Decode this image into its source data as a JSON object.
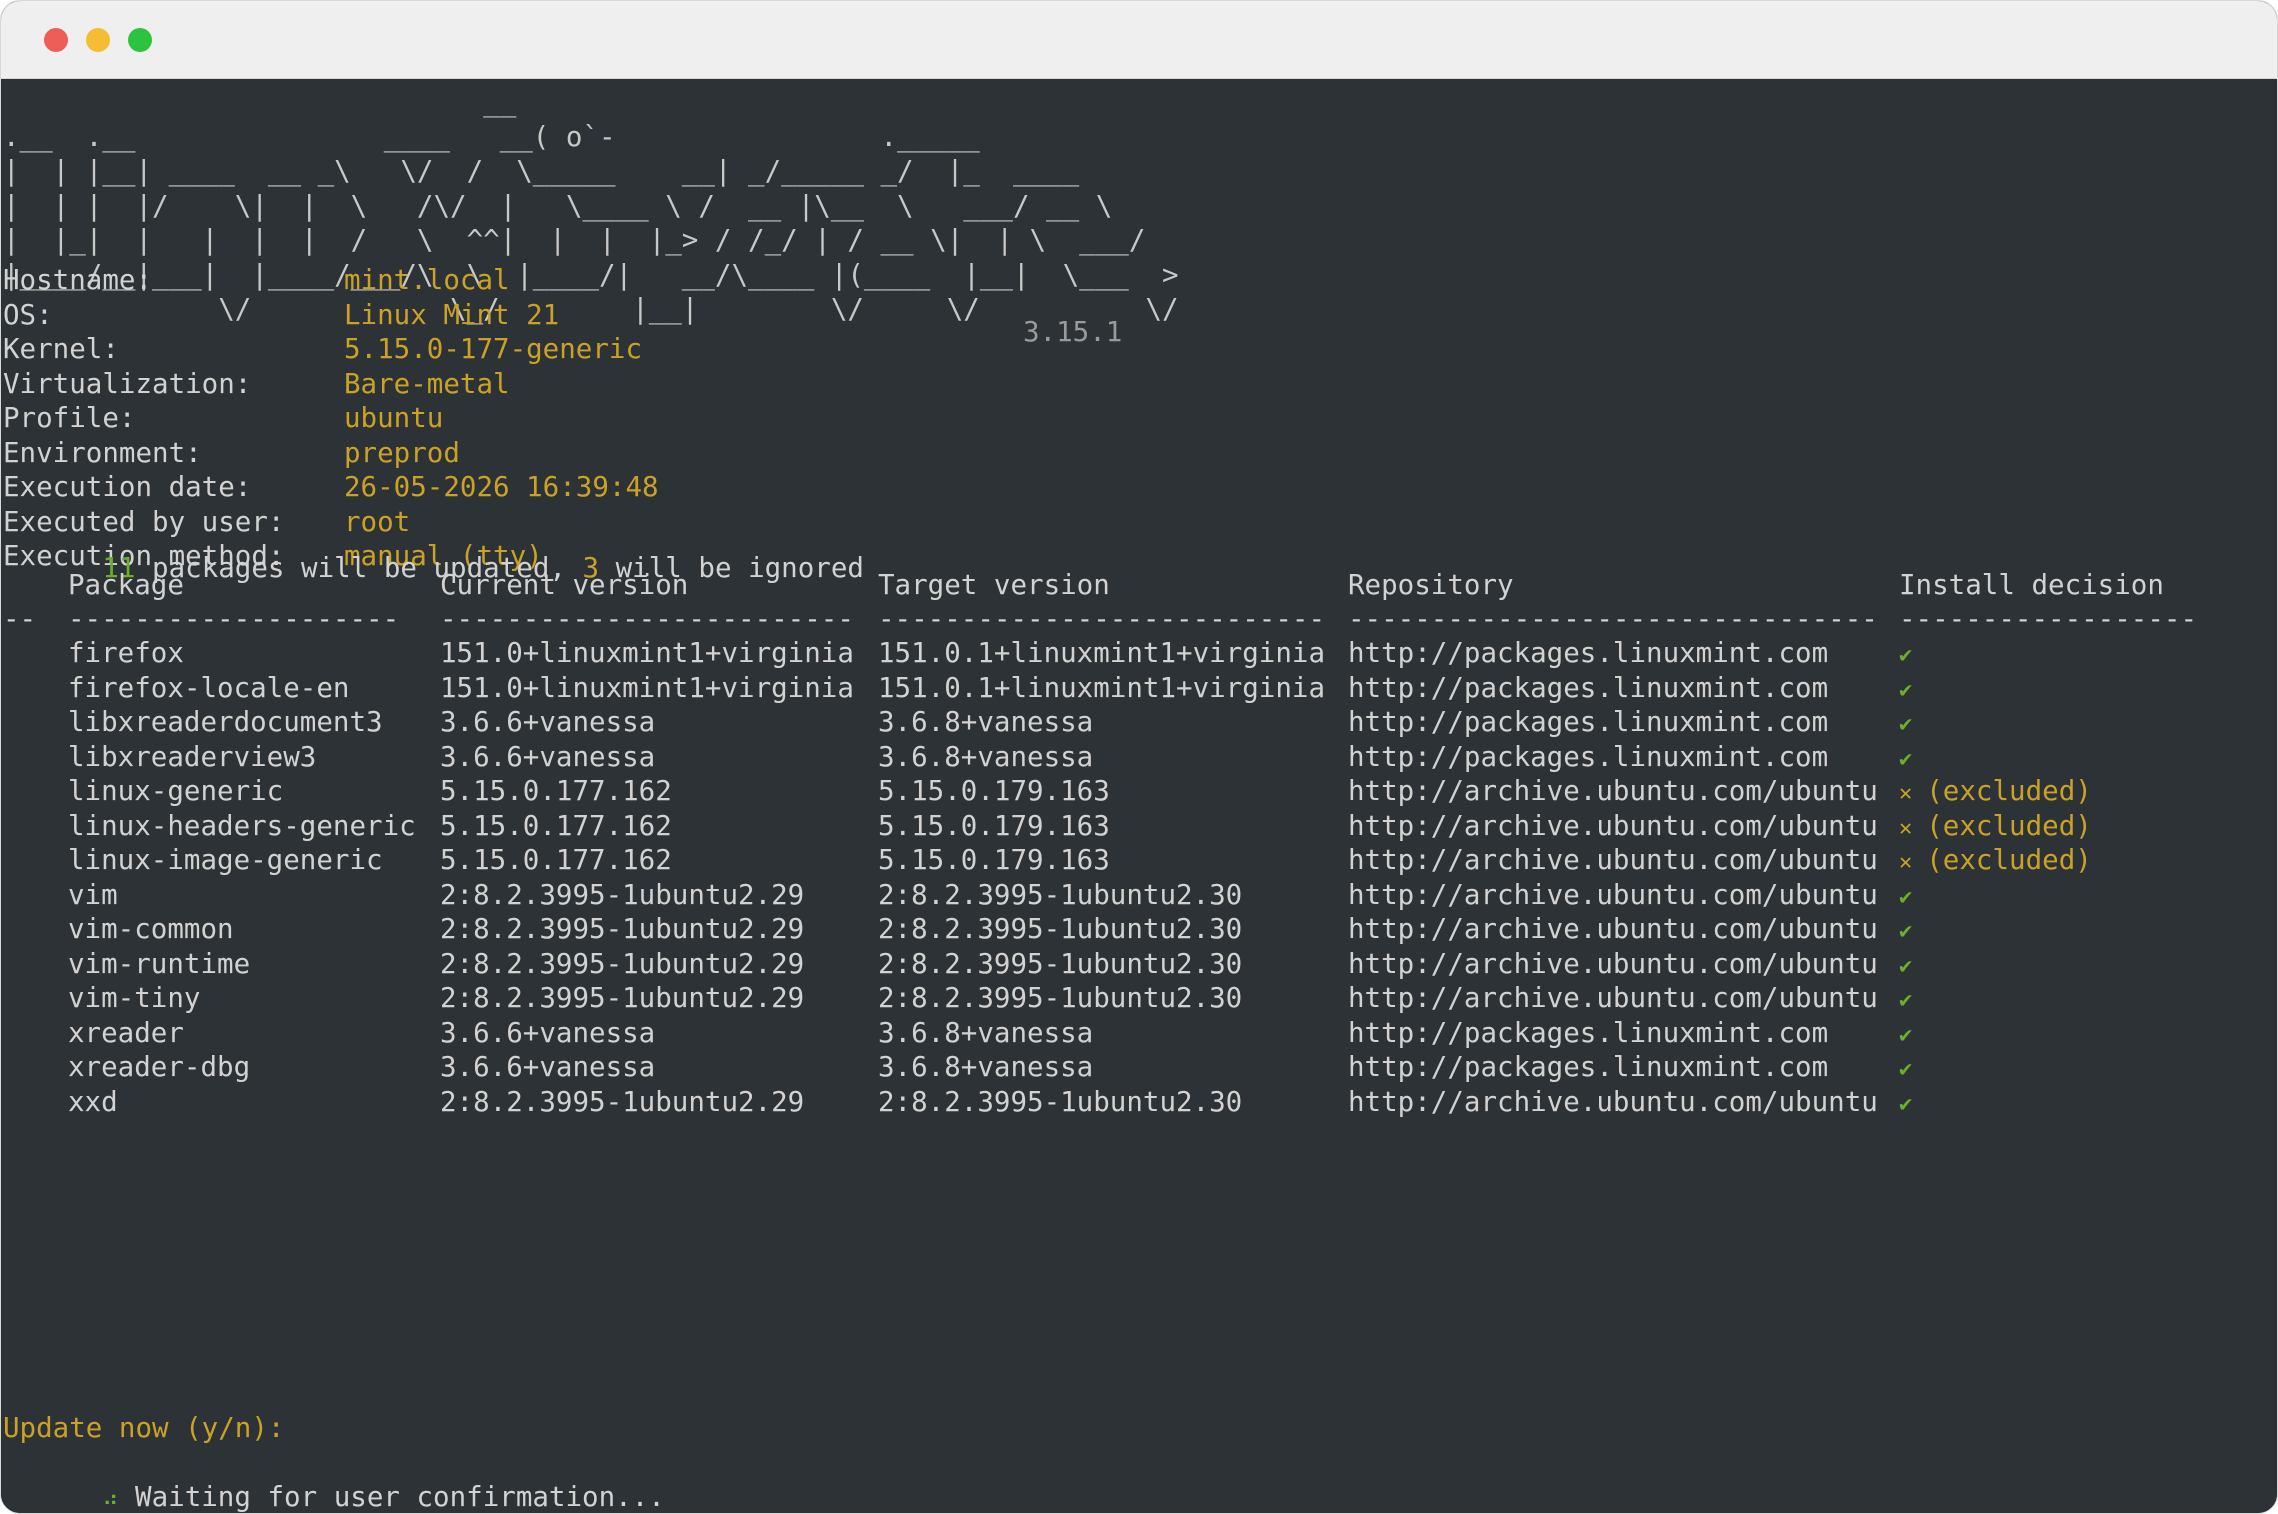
{
  "window": {
    "controls": {
      "close_color": "#ec5e57",
      "minimize_color": "#f5bd31",
      "maximize_color": "#2cc33e"
    }
  },
  "banner": {
    "logo_lines": [
      "                             __",
      ".__  .__               ____   __( o`-                ._____",
      "|  | |__| ____  __ _\\   \\/  /  \\_____    __| _/_____ _/  |_  ____",
      "|  | |  |/    \\|  |  \\   /\\/  |   \\____ \\ /  __ |\\__  \\   ___/ __ \\",
      "|  |_|  |   |  |  |  /   \\  ^^|  |  |  |_> / /_/ | / __ \\|  | \\  ___/",
      "|____/__|___|  |____/___/\\  \\  |____/|   __/\\____ |(____  |__|  \\___  >",
      "             \\/            \\_/        |__|        \\/     \\/          \\/"
    ],
    "version": "3.15.1"
  },
  "system_info": [
    {
      "label": "Hostname:",
      "value": "mint.local"
    },
    {
      "label": "OS:",
      "value": "Linux Mint 21"
    },
    {
      "label": "Kernel:",
      "value": "5.15.0-177-generic"
    },
    {
      "label": "Virtualization:",
      "value": "Bare-metal"
    },
    {
      "label": "Profile:",
      "value": "ubuntu"
    },
    {
      "label": "Environment:",
      "value": "preprod"
    },
    {
      "label": "Execution date:",
      "value": "26-05-2026 16:39:48"
    },
    {
      "label": "Executed by user:",
      "value": "root"
    },
    {
      "label": "Execution method:",
      "value": "manual (tty)"
    }
  ],
  "summary": {
    "update_count": "11",
    "text_1": " packages will be updated, ",
    "ignore_count": "3",
    "text_2": " will be ignored"
  },
  "table": {
    "headers": {
      "package": "Package",
      "current": "Current version",
      "target": "Target version",
      "repository": "Repository",
      "decision": "Install decision"
    },
    "dashes": {
      "num": "--",
      "package": "--------------------",
      "current": "-------------------------",
      "target": "---------------------------",
      "repository": "--------------------------------",
      "decision": "------------------"
    },
    "rows": [
      {
        "package": "firefox",
        "current": "151.0+linuxmint1+virginia",
        "target": "151.0.1+linuxmint1+virginia",
        "repository": "http://packages.linuxmint.com",
        "decision": "✔",
        "excluded": false
      },
      {
        "package": "firefox-locale-en",
        "current": "151.0+linuxmint1+virginia",
        "target": "151.0.1+linuxmint1+virginia",
        "repository": "http://packages.linuxmint.com",
        "decision": "✔",
        "excluded": false
      },
      {
        "package": "libxreaderdocument3",
        "current": "3.6.6+vanessa",
        "target": "3.6.8+vanessa",
        "repository": "http://packages.linuxmint.com",
        "decision": "✔",
        "excluded": false
      },
      {
        "package": "libxreaderview3",
        "current": "3.6.6+vanessa",
        "target": "3.6.8+vanessa",
        "repository": "http://packages.linuxmint.com",
        "decision": "✔",
        "excluded": false
      },
      {
        "package": "linux-generic",
        "current": "5.15.0.177.162",
        "target": "5.15.0.179.163",
        "repository": "http://archive.ubuntu.com/ubuntu",
        "decision": "✕",
        "note": "(excluded)",
        "excluded": true
      },
      {
        "package": "linux-headers-generic",
        "current": "5.15.0.177.162",
        "target": "5.15.0.179.163",
        "repository": "http://archive.ubuntu.com/ubuntu",
        "decision": "✕",
        "note": "(excluded)",
        "excluded": true
      },
      {
        "package": "linux-image-generic",
        "current": "5.15.0.177.162",
        "target": "5.15.0.179.163",
        "repository": "http://archive.ubuntu.com/ubuntu",
        "decision": "✕",
        "note": "(excluded)",
        "excluded": true
      },
      {
        "package": "vim",
        "current": "2:8.2.3995-1ubuntu2.29",
        "target": "2:8.2.3995-1ubuntu2.30",
        "repository": "http://archive.ubuntu.com/ubuntu",
        "decision": "✔",
        "excluded": false
      },
      {
        "package": "vim-common",
        "current": "2:8.2.3995-1ubuntu2.29",
        "target": "2:8.2.3995-1ubuntu2.30",
        "repository": "http://archive.ubuntu.com/ubuntu",
        "decision": "✔",
        "excluded": false
      },
      {
        "package": "vim-runtime",
        "current": "2:8.2.3995-1ubuntu2.29",
        "target": "2:8.2.3995-1ubuntu2.30",
        "repository": "http://archive.ubuntu.com/ubuntu",
        "decision": "✔",
        "excluded": false
      },
      {
        "package": "vim-tiny",
        "current": "2:8.2.3995-1ubuntu2.29",
        "target": "2:8.2.3995-1ubuntu2.30",
        "repository": "http://archive.ubuntu.com/ubuntu",
        "decision": "✔",
        "excluded": false
      },
      {
        "package": "xreader",
        "current": "3.6.6+vanessa",
        "target": "3.6.8+vanessa",
        "repository": "http://packages.linuxmint.com",
        "decision": "✔",
        "excluded": false
      },
      {
        "package": "xreader-dbg",
        "current": "3.6.6+vanessa",
        "target": "3.6.8+vanessa",
        "repository": "http://packages.linuxmint.com",
        "decision": "✔",
        "excluded": false
      },
      {
        "package": "xxd",
        "current": "2:8.2.3995-1ubuntu2.29",
        "target": "2:8.2.3995-1ubuntu2.30",
        "repository": "http://archive.ubuntu.com/ubuntu",
        "decision": "✔",
        "excluded": false
      }
    ]
  },
  "prompt": {
    "question": "Update now (y/n):",
    "spinner": "⠴",
    "waiting": " Waiting for user confirmation..."
  },
  "colors": {
    "terminal_bg": "#2c3235",
    "text": "#d2d2d2",
    "accent_yellow": "#c9a227",
    "accent_green": "#6fae2b"
  }
}
